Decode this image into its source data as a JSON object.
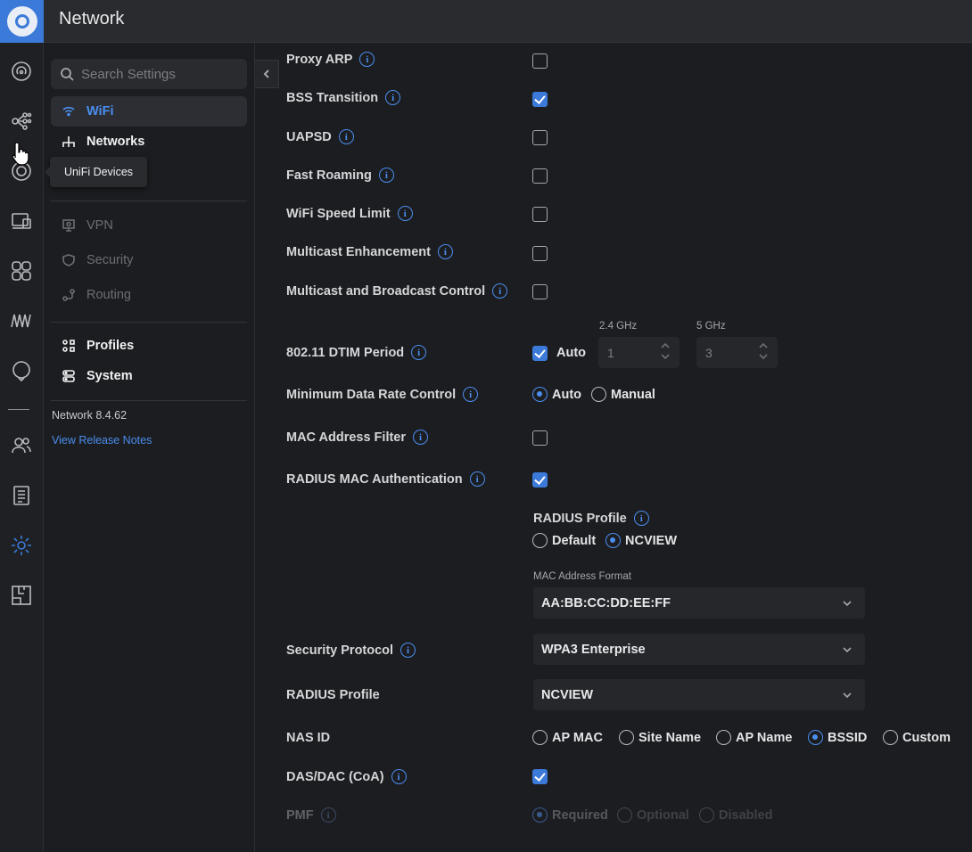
{
  "app": {
    "title": "Network"
  },
  "sidebar": {
    "search_placeholder": "Search Settings",
    "items": [
      {
        "label": "WiFi",
        "icon": "wifi-icon",
        "state": "active"
      },
      {
        "label": "Networks",
        "icon": "networks-icon",
        "state": "normal"
      },
      {
        "label": "VPN",
        "icon": "vpn-icon",
        "state": "disabled"
      },
      {
        "label": "Security",
        "icon": "shield-icon",
        "state": "disabled"
      },
      {
        "label": "Routing",
        "icon": "routing-icon",
        "state": "disabled"
      },
      {
        "label": "Profiles",
        "icon": "profiles-icon",
        "state": "normal"
      },
      {
        "label": "System",
        "icon": "system-icon",
        "state": "normal"
      }
    ],
    "version": "Network 8.4.62",
    "release_notes": "View Release Notes"
  },
  "tooltip": "UniFi Devices",
  "settings": {
    "proxy_arp": {
      "label": "Proxy ARP",
      "checked": false
    },
    "bss_transition": {
      "label": "BSS Transition",
      "checked": true
    },
    "uapsd": {
      "label": "UAPSD",
      "checked": false
    },
    "fast_roaming": {
      "label": "Fast Roaming",
      "checked": false
    },
    "wifi_speed_limit": {
      "label": "WiFi Speed Limit",
      "checked": false
    },
    "multicast_enhancement": {
      "label": "Multicast Enhancement",
      "checked": false
    },
    "multicast_broadcast": {
      "label": "Multicast and Broadcast Control",
      "checked": false
    },
    "dtim": {
      "label": "802.11 DTIM Period",
      "auto_label": "Auto",
      "auto_checked": true,
      "band_24_label": "2.4 GHz",
      "band_24_value": "1",
      "band_5_label": "5 GHz",
      "band_5_value": "3"
    },
    "min_data_rate": {
      "label": "Minimum Data Rate Control",
      "options": [
        "Auto",
        "Manual"
      ],
      "selected": "Auto"
    },
    "mac_filter": {
      "label": "MAC Address Filter",
      "checked": false
    },
    "radius_mac_auth": {
      "label": "RADIUS MAC Authentication",
      "checked": true,
      "profile_label": "RADIUS Profile",
      "profile_options": [
        "Default",
        "NCVIEW"
      ],
      "profile_selected": "NCVIEW",
      "mac_format_label": "MAC Address Format",
      "mac_format_value": "AA:BB:CC:DD:EE:FF"
    },
    "security_protocol": {
      "label": "Security Protocol",
      "value": "WPA3 Enterprise"
    },
    "radius_profile": {
      "label": "RADIUS Profile",
      "value": "NCVIEW"
    },
    "nas_id": {
      "label": "NAS ID",
      "options": [
        "AP MAC",
        "Site Name",
        "AP Name",
        "BSSID",
        "Custom"
      ],
      "selected": "BSSID"
    },
    "das_dac": {
      "label": "DAS/DAC (CoA)",
      "checked": true
    },
    "pmf": {
      "label": "PMF",
      "options": [
        "Required",
        "Optional",
        "Disabled"
      ],
      "selected": "Required",
      "disabled": true
    }
  },
  "colors": {
    "accent": "#3b7ad9",
    "link": "#4a8ef0",
    "background": "#1c1d20",
    "topbar": "#2a2b2f"
  }
}
